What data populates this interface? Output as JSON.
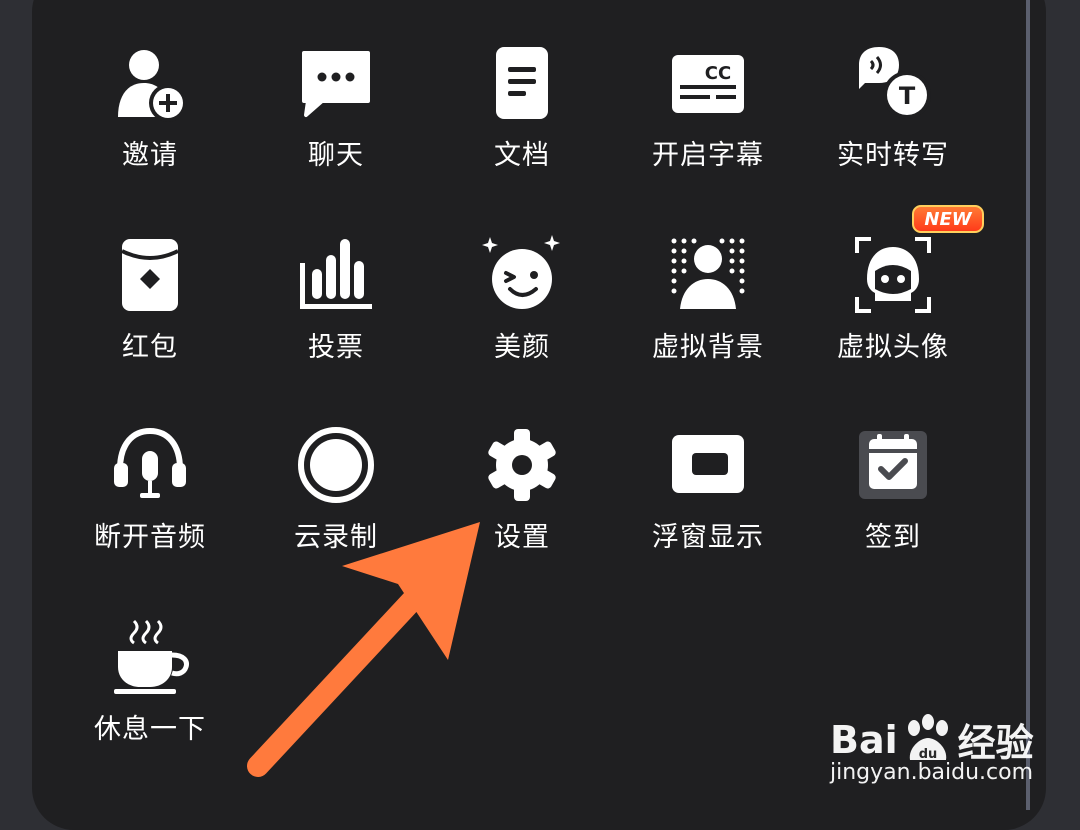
{
  "menu": {
    "items": [
      {
        "label": "邀请",
        "icon": "invite-icon"
      },
      {
        "label": "聊天",
        "icon": "chat-icon"
      },
      {
        "label": "文档",
        "icon": "document-icon"
      },
      {
        "label": "开启字幕",
        "icon": "captions-icon"
      },
      {
        "label": "实时转写",
        "icon": "transcribe-icon"
      },
      {
        "label": "红包",
        "icon": "red-packet-icon"
      },
      {
        "label": "投票",
        "icon": "vote-icon"
      },
      {
        "label": "美颜",
        "icon": "beauty-icon"
      },
      {
        "label": "虚拟背景",
        "icon": "virtual-background-icon"
      },
      {
        "label": "虚拟头像",
        "icon": "virtual-avatar-icon"
      },
      {
        "label": "断开音频",
        "icon": "headset-icon"
      },
      {
        "label": "云录制",
        "icon": "record-icon"
      },
      {
        "label": "设置",
        "icon": "gear-icon"
      },
      {
        "label": "浮窗显示",
        "icon": "floating-window-icon"
      },
      {
        "label": "签到",
        "icon": "check-in-icon"
      },
      {
        "label": "休息一下",
        "icon": "coffee-icon"
      }
    ],
    "new_badge": "NEW"
  },
  "watermark": {
    "brand_left": "Bai",
    "brand_mid": "du",
    "brand_right": "经验",
    "url": "jingyan.baidu.com"
  },
  "colors": {
    "background": "#1f1f21",
    "arrow": "#ff7a3d",
    "badge": "#ff4a1f"
  }
}
